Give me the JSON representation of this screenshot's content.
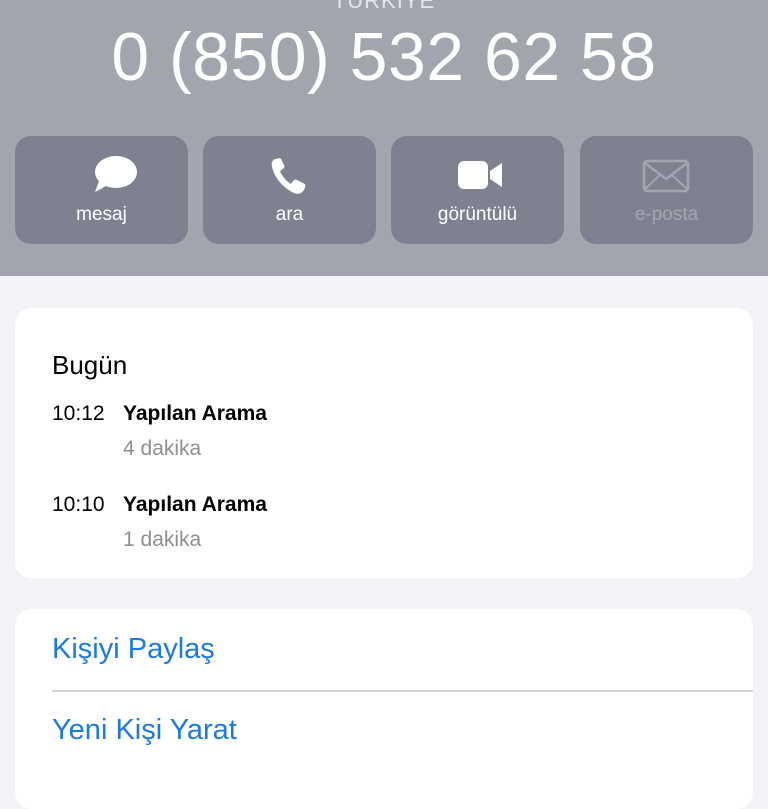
{
  "header": {
    "country": "TÜRKİYE",
    "phone_number": "0 (850) 532 62 58"
  },
  "actions": [
    {
      "label": "mesaj",
      "icon": "message-bubble-icon",
      "enabled": true
    },
    {
      "label": "ara",
      "icon": "phone-icon",
      "enabled": true
    },
    {
      "label": "görüntülü",
      "icon": "video-camera-icon",
      "enabled": true
    },
    {
      "label": "e-posta",
      "icon": "envelope-icon",
      "enabled": false
    }
  ],
  "recents": {
    "title": "Bugün",
    "calls": [
      {
        "time": "10:12",
        "type": "Yapılan Arama",
        "duration": "4 dakika"
      },
      {
        "time": "10:10",
        "type": "Yapılan Arama",
        "duration": "1 dakika"
      }
    ]
  },
  "contact_actions": {
    "share_contact": "Kişiyi Paylaş",
    "create_new_contact": "Yeni Kişi Yarat"
  },
  "colors": {
    "header_bg": "#a3a5ae",
    "action_bg": "#7f8191",
    "link": "#1a7ae6",
    "page_bg": "#f2f2f7"
  }
}
